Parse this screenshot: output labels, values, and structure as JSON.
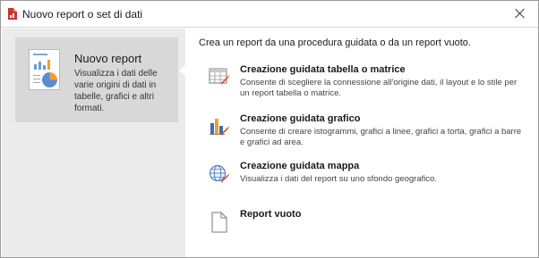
{
  "window": {
    "title": "Nuovo report o set di dati"
  },
  "sidebar": {
    "items": [
      {
        "title": "Nuovo report",
        "description": "Visualizza i dati delle varie origini di dati in tabelle, grafici e altri formati."
      }
    ]
  },
  "main": {
    "intro": "Crea un report da una procedura guidata o da un report vuoto.",
    "options": [
      {
        "title": "Creazione guidata tabella o matrice",
        "description": "Consente di scegliere la connessione all'origine dati, il layout e lo stile per un report tabella o matrice.",
        "icon": "table-wizard-icon"
      },
      {
        "title": "Creazione guidata grafico",
        "description": "Consente di creare istogrammi, grafici a linee, grafici a torta, grafici a barre e grafici ad area.",
        "icon": "chart-wizard-icon"
      },
      {
        "title": "Creazione guidata mappa",
        "description": "Visualizza i dati del report su uno sfondo geografico.",
        "icon": "globe-map-icon"
      },
      {
        "title": "Report vuoto",
        "description": "",
        "icon": "blank-document-icon"
      }
    ]
  }
}
